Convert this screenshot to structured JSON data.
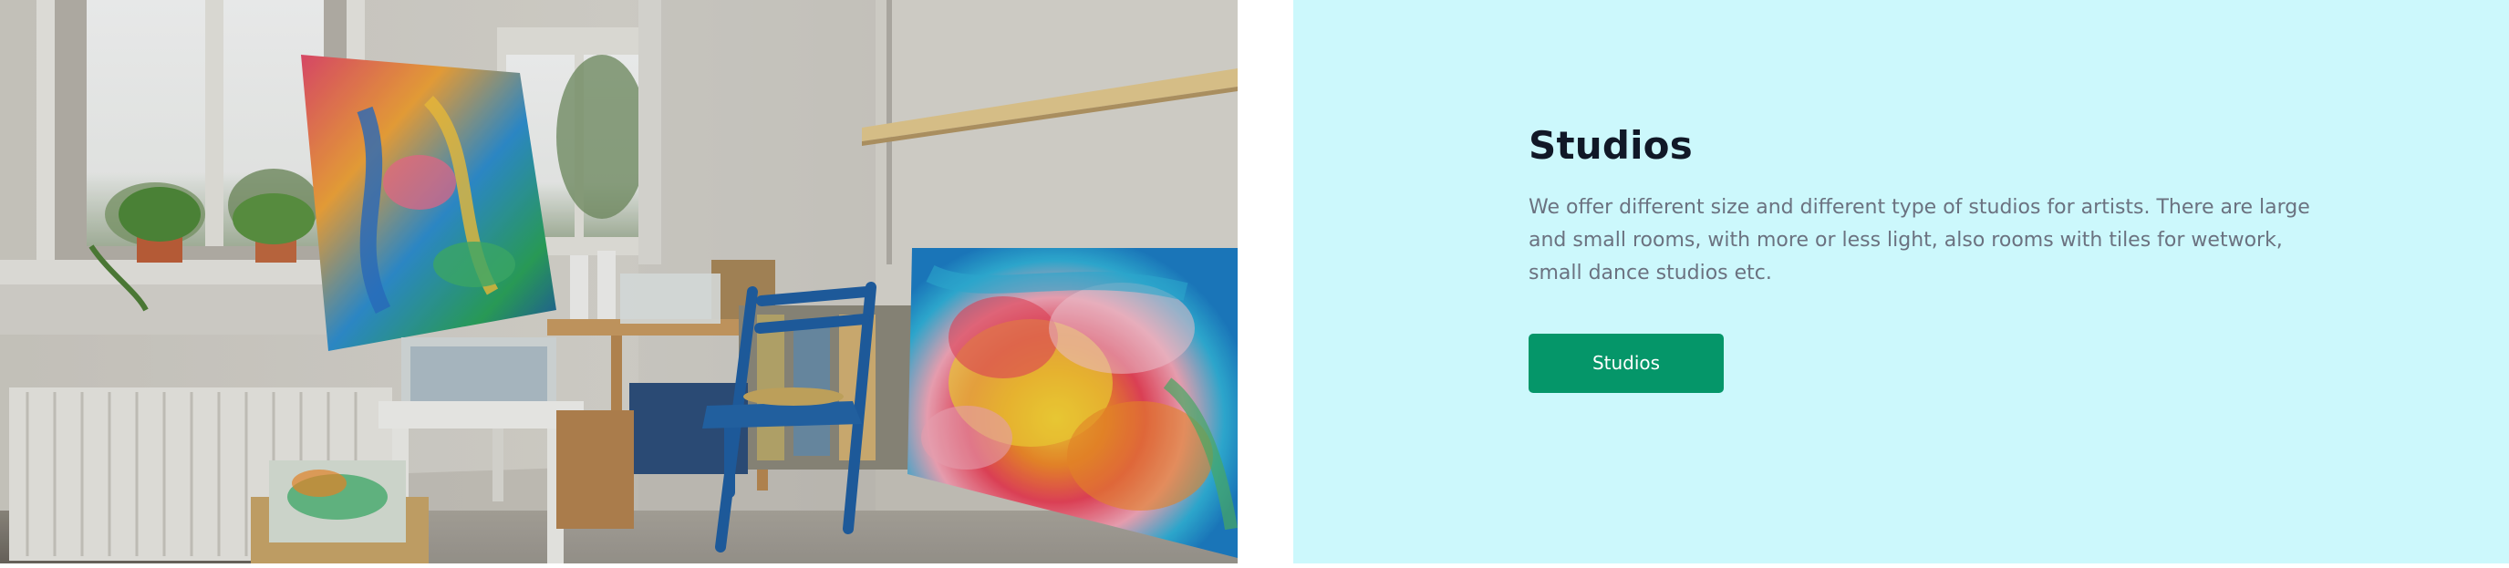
{
  "photo": {
    "subject": "art studio room with easel painting, canvases, window, shelf and blue chair"
  },
  "section": {
    "title": "Studios",
    "description": "We offer different size and different type of studios for artists. There are large and small rooms, with more or less light, also rooms with tiles for wetwork, small dance studios etc.",
    "button_label": "Studios"
  },
  "colors": {
    "panel_background": "#ccf8fc",
    "button_background": "#059669",
    "title_text": "#111827",
    "description_text": "#6b7280"
  }
}
